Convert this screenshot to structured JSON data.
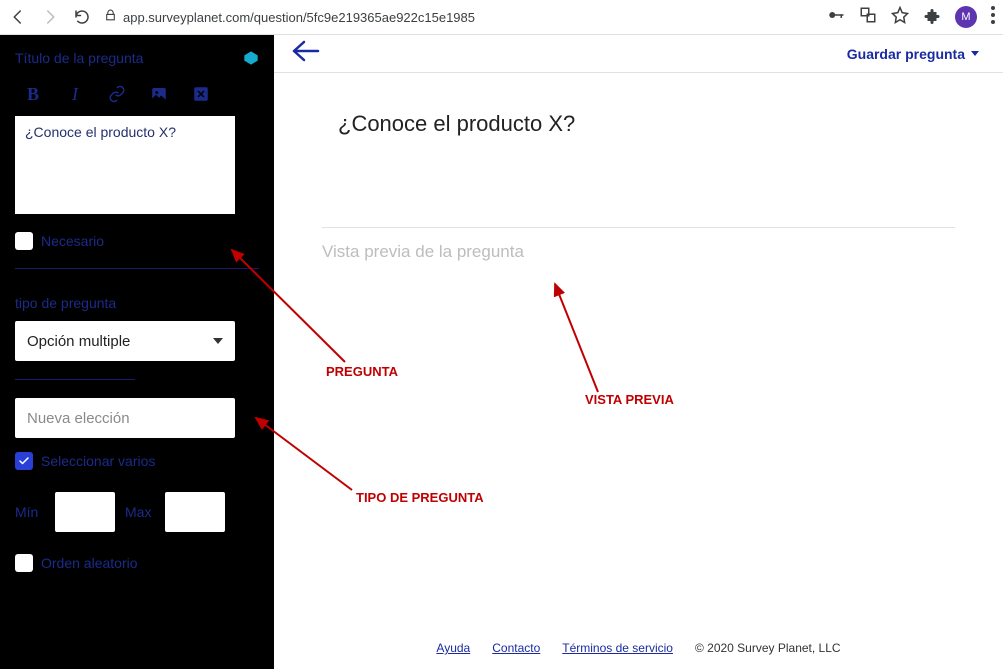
{
  "browser": {
    "url": "app.surveyplanet.com/question/5fc9e219365ae922c15e1985",
    "avatar_letter": "M"
  },
  "sidebar": {
    "title_label": "Título de la pregunta",
    "question_title_value": "¿Conoce el producto X?",
    "necessary_label": "Necesario",
    "type_section_label": "tipo de pregunta",
    "type_selected": "Opción multiple",
    "new_choice_placeholder": "Nueva elección",
    "select_multiple_label": "Seleccionar varios",
    "min_label": "Mín",
    "max_label": "Max",
    "random_order_label": "Orden aleatorio"
  },
  "main": {
    "save_label": "Guardar pregunta",
    "question_preview_title": "¿Conoce el producto X?",
    "preview_label": "Vista previa de la pregunta"
  },
  "footer": {
    "help": "Ayuda",
    "contact": "Contacto",
    "terms": "Términos de servicio",
    "copyright": "© 2020 Survey Planet, LLC"
  },
  "annotations": {
    "pregunta": "PREGUNTA",
    "tipo": "TIPO DE PREGUNTA",
    "vista": "VISTA PREVIA"
  }
}
